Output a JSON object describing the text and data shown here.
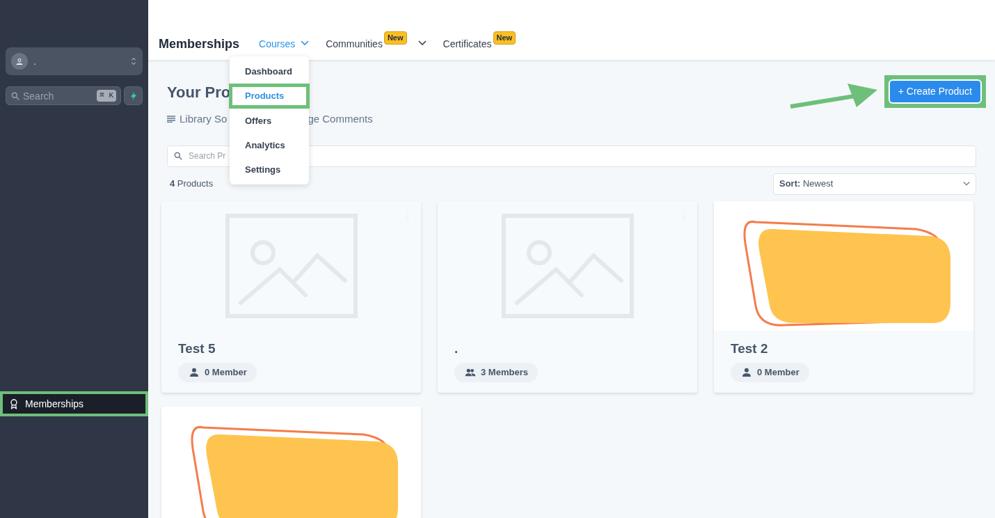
{
  "sidebar": {
    "account": {
      "name": "."
    },
    "search": {
      "placeholder": "Search",
      "shortcut": "⌘ K"
    },
    "items": [
      {
        "label": "Memberships",
        "selected": true,
        "highlighted": true
      }
    ]
  },
  "header": {
    "title": "Memberships",
    "tabs": [
      {
        "label": "Courses",
        "selected": true,
        "caret": true
      },
      {
        "label": "Communities",
        "selected": false,
        "badge": "New",
        "caret": true
      },
      {
        "label": "Certificates",
        "selected": false,
        "badge": "New",
        "caret": false
      }
    ]
  },
  "courses_menu": {
    "items": [
      {
        "label": "Dashboard",
        "selected": false,
        "highlighted": false
      },
      {
        "label": "Products",
        "selected": true,
        "highlighted": true
      },
      {
        "label": "Offers",
        "selected": false,
        "highlighted": false
      },
      {
        "label": "Analytics",
        "selected": false,
        "highlighted": false
      },
      {
        "label": "Settings",
        "selected": false,
        "highlighted": false
      }
    ]
  },
  "page": {
    "title": "Your Pro",
    "links": [
      "Library So",
      "ge Comments"
    ],
    "create_button": {
      "label": "+ Create Product",
      "highlighted": true
    },
    "search": {
      "placeholder": "Search Pr"
    },
    "count": "4",
    "count_label": "Products",
    "sort": {
      "label": "Sort:",
      "value": "Newest"
    }
  },
  "products": [
    {
      "title": "Test 5",
      "members": "0 Member",
      "kind": "placeholder",
      "group": false
    },
    {
      "title": ".",
      "members": "3 Members",
      "kind": "placeholder",
      "group": true
    },
    {
      "title": "Test 2",
      "members": "0 Member",
      "kind": "picture",
      "group": false
    },
    {
      "kind": "picture"
    }
  ]
}
